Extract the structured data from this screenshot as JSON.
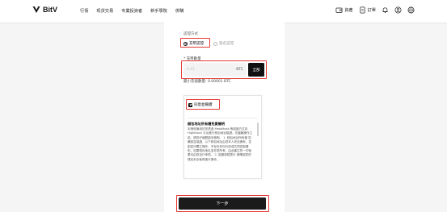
{
  "header": {
    "logo_text": "BitV",
    "nav": [
      "行情",
      "现货交易",
      "专業投資者",
      "新手學院",
      "併購"
    ],
    "right": {
      "assets_label": "資產",
      "orders_label": "訂單"
    },
    "icons": [
      "wallet-icon",
      "orders-icon",
      "bell-icon",
      "user-icon",
      "globe-icon"
    ]
  },
  "form": {
    "method_label": "認證方式",
    "radio_selected_label": "充幣認證",
    "radio_other_label": "簽名認證",
    "amount_label": "* 充幣數量",
    "amount_placeholder": "0.01",
    "amount_unit": "BTC",
    "all_button": "全部",
    "min_amount_text": "最小充值數量: 0.00001 BTC",
    "agree_label": "同意並繼續",
    "terms_title": "錢包地址所有權免責聲明",
    "terms_text": "本聲明適用於您透過 MetaMask 等認證方式向 HighBlock 平台進行錢包地址驗證。在繼續操作之前，請您仔細閱讀本聲明。 1. 錢包地址所有權 您確認並保證，以下錢包地址由您本人完全擁有、控制並可獨立操作，不存在任何代持或共同控制情形。如果錢包地址並非您所有，由此產生的一切後果均由您自行承擔。 2. 認證風險提示 請確認您的錢包安全後再進行操作。",
    "next_button": "下一步"
  },
  "accent_color": "#e53935"
}
